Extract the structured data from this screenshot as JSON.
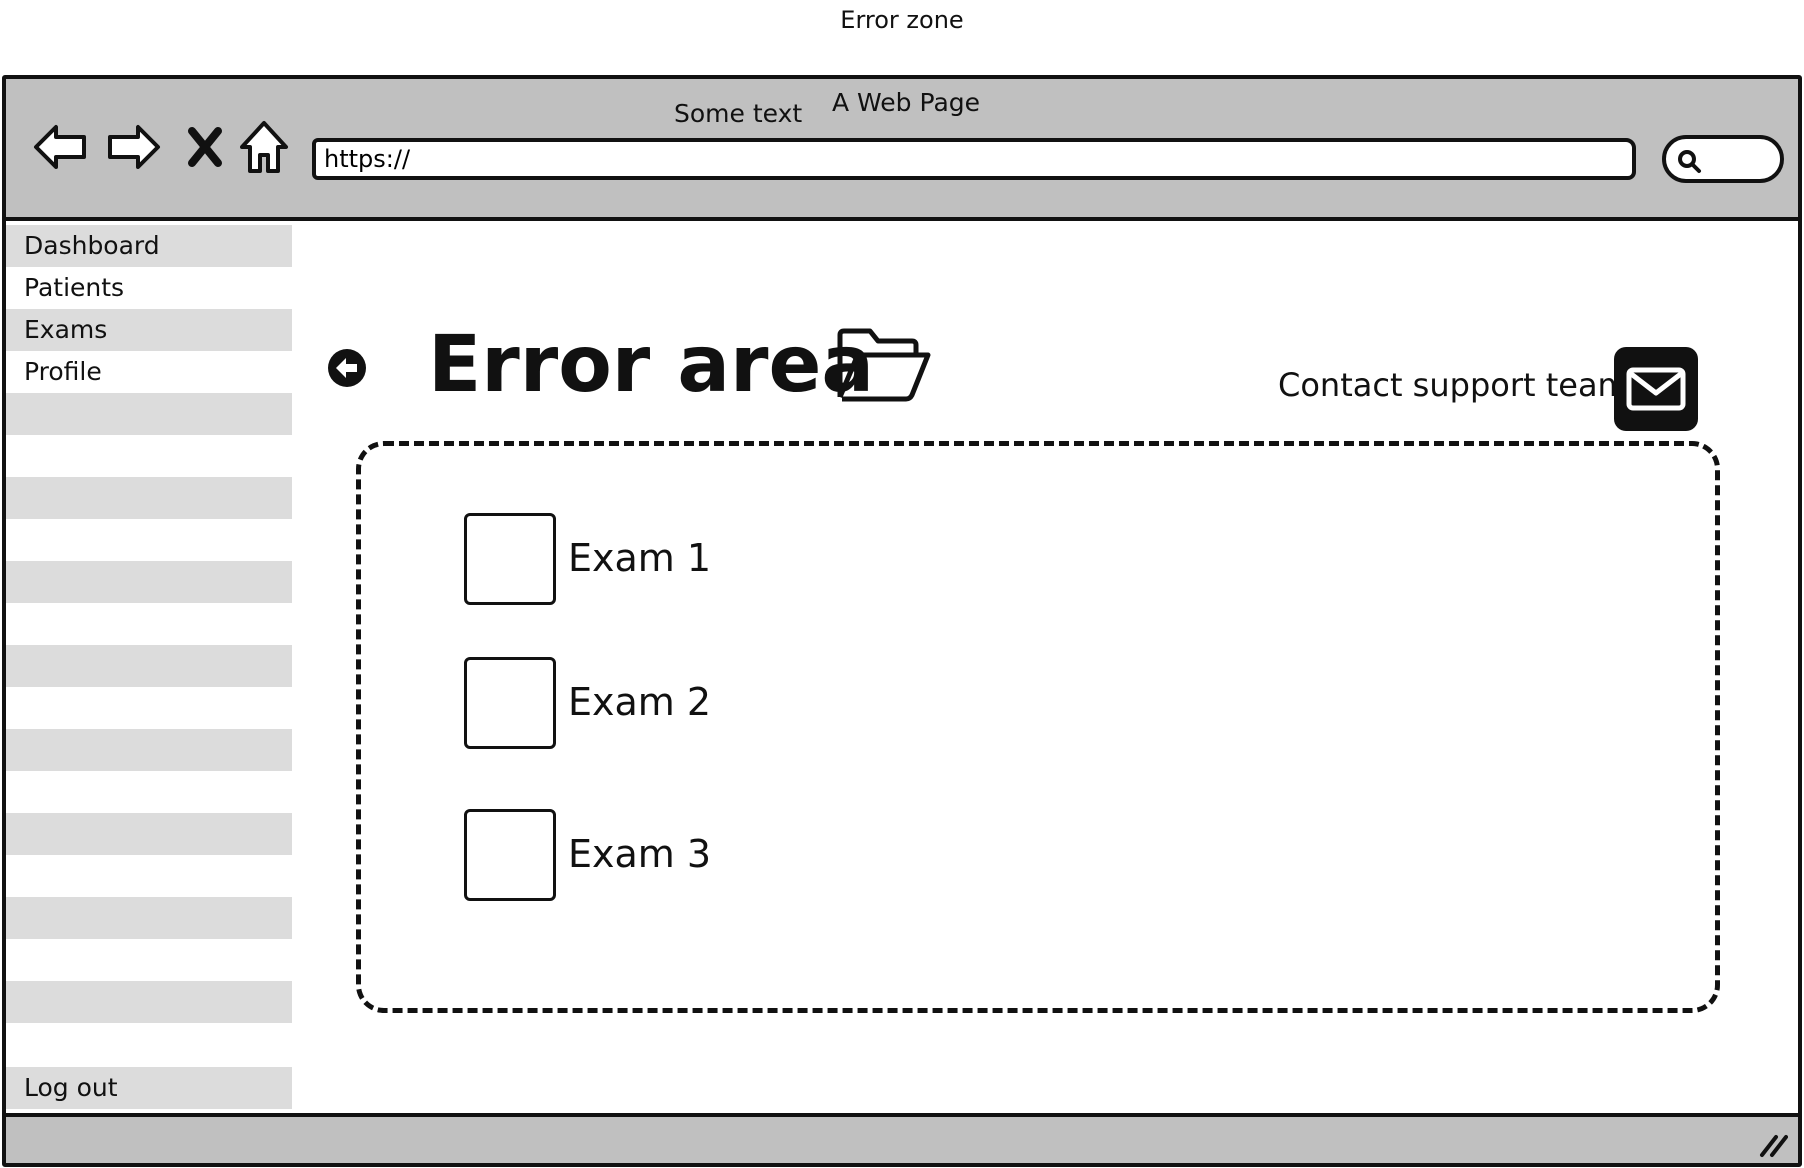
{
  "zone_label": "Error zone",
  "window": {
    "title": "A Web Page",
    "subtitle_text": "Some text",
    "url_value": "https://"
  },
  "toolbar_icons": [
    "back-arrow-icon",
    "forward-arrow-icon",
    "close-x-icon",
    "home-icon",
    "search-icon"
  ],
  "sidebar": {
    "items": [
      {
        "label": "Dashboard"
      },
      {
        "label": "Patients"
      },
      {
        "label": "Exams"
      },
      {
        "label": "Profile"
      }
    ],
    "logout_label": "Log out"
  },
  "main": {
    "title": "Error area",
    "contact_label": "Contact support team",
    "exams": [
      {
        "label": "Exam 1"
      },
      {
        "label": "Exam 2"
      },
      {
        "label": "Exam 3"
      }
    ]
  },
  "colors": {
    "chrome": "#c0c0c0",
    "stripe": "#dcdcdc",
    "ink": "#111111"
  }
}
